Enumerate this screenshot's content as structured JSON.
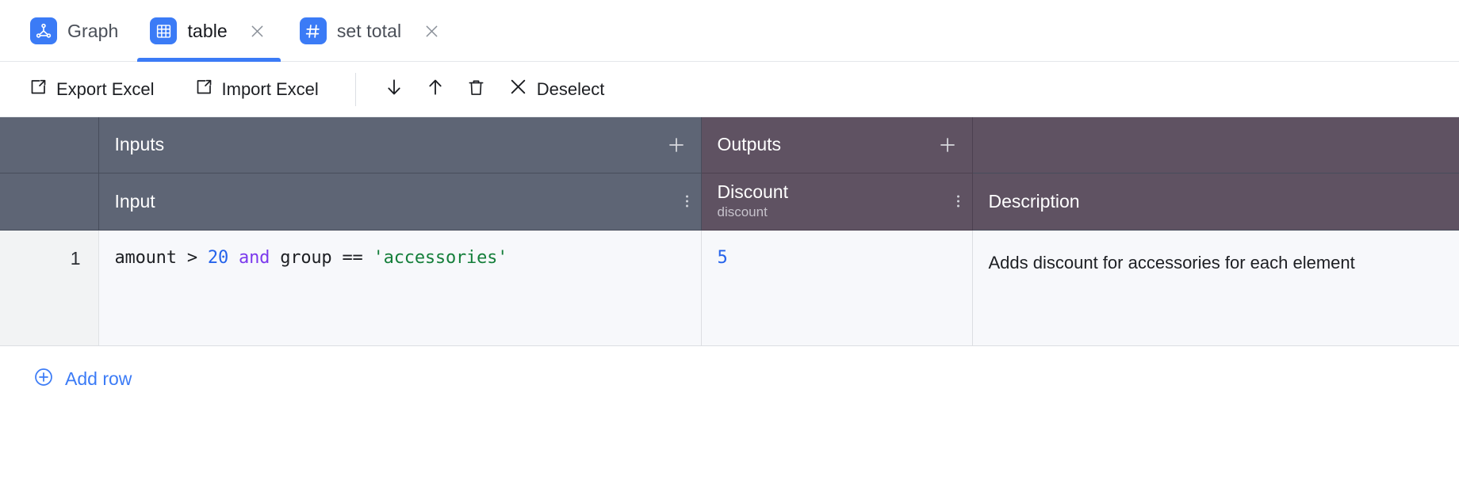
{
  "colors": {
    "accent": "#3b7bf6",
    "header_inputs_bg": "#5e6575",
    "header_outputs_bg": "#5f5262",
    "cell_bg": "#f7f8fb",
    "rownum_bg": "#f2f3f4",
    "number_token": "#2563eb",
    "keyword_token": "#7c3aed",
    "string_token": "#157f3b"
  },
  "tabs": [
    {
      "label": "Graph",
      "icon": "graph-node-icon",
      "active": false,
      "closable": false
    },
    {
      "label": "table",
      "icon": "table-grid-icon",
      "active": true,
      "closable": true,
      "close_icon": "close-icon"
    },
    {
      "label": "set total",
      "icon": "hash-icon",
      "active": false,
      "closable": true,
      "close_icon": "close-icon"
    }
  ],
  "toolbar": {
    "export_excel_label": "Export Excel",
    "export_excel_icon": "export-icon",
    "import_excel_label": "Import Excel",
    "import_excel_icon": "import-icon",
    "move_down_icon": "arrow-down-icon",
    "move_up_icon": "arrow-up-icon",
    "delete_icon": "trash-icon",
    "deselect_label": "Deselect",
    "deselect_icon": "x-icon"
  },
  "table": {
    "groups": [
      {
        "label": "Inputs",
        "add_icon": "plus-icon",
        "kind": "inputs"
      },
      {
        "label": "Outputs",
        "add_icon": "plus-icon",
        "kind": "outputs"
      },
      {
        "label": "",
        "kind": "meta"
      }
    ],
    "columns": [
      {
        "name": "Input",
        "sub": "",
        "menu_icon": "dots-vertical-icon",
        "kind": "inputs"
      },
      {
        "name": "Discount",
        "sub": "discount",
        "menu_icon": "dots-vertical-icon",
        "kind": "outputs"
      },
      {
        "name": "Description",
        "sub": "",
        "kind": "meta"
      }
    ],
    "rows": [
      {
        "number": "1",
        "input_tokens": [
          {
            "text": "amount > ",
            "type": "plain"
          },
          {
            "text": "20",
            "type": "number"
          },
          {
            "text": " ",
            "type": "plain"
          },
          {
            "text": "and",
            "type": "keyword"
          },
          {
            "text": " group == ",
            "type": "plain"
          },
          {
            "text": "'accessories'",
            "type": "string"
          }
        ],
        "input_text": "amount > 20 and group == 'accessories'",
        "discount": "5",
        "description": "Adds discount for accessories for each element"
      }
    ],
    "add_row_label": "Add row",
    "add_row_icon": "plus-circle-icon"
  }
}
